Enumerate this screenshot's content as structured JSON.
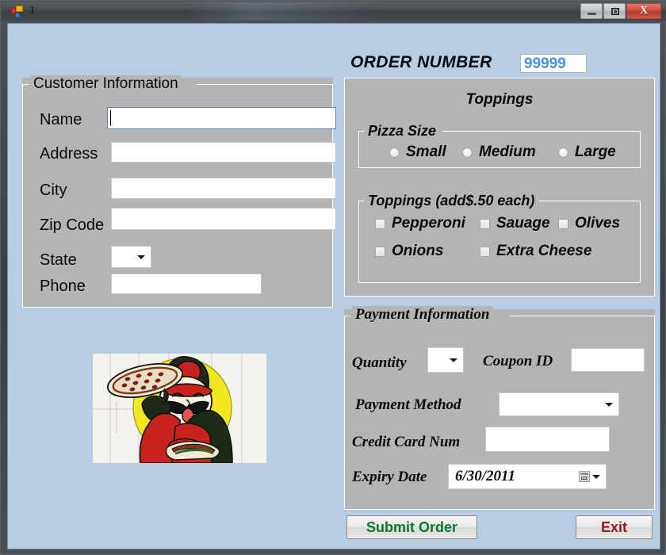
{
  "window": {
    "title": "1",
    "icon": "vb-form-icon",
    "buttons": {
      "minimize": "minimize-icon",
      "maximize": "maximize-icon",
      "close": "X"
    }
  },
  "order": {
    "label": "ORDER NUMBER",
    "number": "99999",
    "number_color": "#4f8fe0"
  },
  "customer": {
    "title": "Customer Information",
    "fields": [
      {
        "label": "Name",
        "value": "",
        "type": "text",
        "focused": true
      },
      {
        "label": "Address",
        "value": "",
        "type": "text",
        "focused": false
      },
      {
        "label": "City",
        "value": "",
        "type": "text",
        "focused": false
      },
      {
        "label": "Zip Code",
        "value": "",
        "type": "text",
        "focused": false
      },
      {
        "label": "State",
        "value": "",
        "type": "select",
        "focused": false
      },
      {
        "label": "Phone",
        "value": "",
        "type": "text",
        "focused": false
      }
    ]
  },
  "toppings": {
    "title": "Toppings",
    "size_group": {
      "title": "Pizza Size",
      "options": [
        {
          "label": "Small",
          "checked": false
        },
        {
          "label": "Medium",
          "checked": false
        },
        {
          "label": "Large",
          "checked": false
        }
      ]
    },
    "topping_group": {
      "title": "Toppings (add$.50 each)",
      "options": [
        {
          "label": "Pepperoni",
          "checked": false
        },
        {
          "label": "Sauage",
          "checked": false
        },
        {
          "label": "Olives",
          "checked": false
        },
        {
          "label": "Onions",
          "checked": false
        },
        {
          "label": "Extra Cheese",
          "checked": false
        }
      ]
    }
  },
  "payment": {
    "title": "Payment Information",
    "quantity_label": "Quantity",
    "quantity_value": "",
    "coupon_label": "Coupon ID",
    "coupon_value": "",
    "method_label": "Payment Method",
    "method_value": "",
    "credit_card_label": "Credit Card Num",
    "credit_card_value": "",
    "expiry_label": "Expiry Date",
    "expiry_value": "6/30/2011",
    "expiry_icon": "calendar-icon"
  },
  "actions": {
    "submit_label": "Submit Order",
    "submit_color": "#0a7a25",
    "exit_label": "Exit",
    "exit_color": "#9a1717"
  },
  "graphic": {
    "name": "pizza-chef-stained-glass-image",
    "alt": "Stained glass pizza chef holding a pizza"
  },
  "colors": {
    "form_background": "#b8cce4",
    "panel_background": "#b4b4b4",
    "titlebar": "#44474c"
  }
}
